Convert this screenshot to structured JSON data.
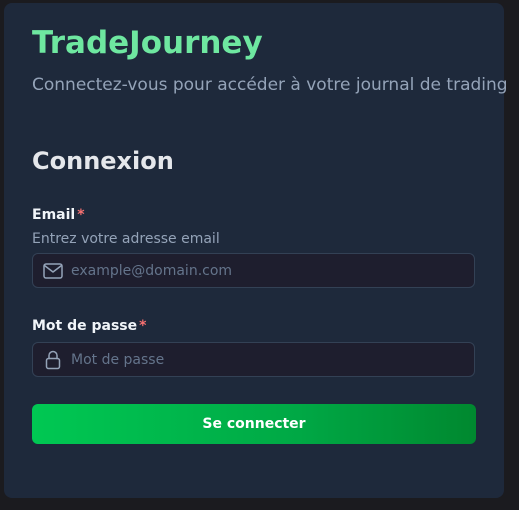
{
  "brand": {
    "name": "TradeJourney",
    "color": "#6ee7a0"
  },
  "subtitle": "Connectez-vous pour accéder à votre journal de trading",
  "form": {
    "heading": "Connexion",
    "email": {
      "label": "Email",
      "required_mark": "*",
      "hint": "Entrez votre adresse email",
      "placeholder": "example@domain.com",
      "value": "",
      "icon": "mail-icon"
    },
    "password": {
      "label": "Mot de passe",
      "required_mark": "*",
      "placeholder": "Mot de passe",
      "value": "",
      "icon": "lock-icon"
    },
    "submit_label": "Se connecter"
  },
  "colors": {
    "background": "#1b1b1f",
    "card": "#1e293b",
    "input_bg": "#1e1e2e",
    "accent": "#00c853",
    "required": "#f87171"
  }
}
